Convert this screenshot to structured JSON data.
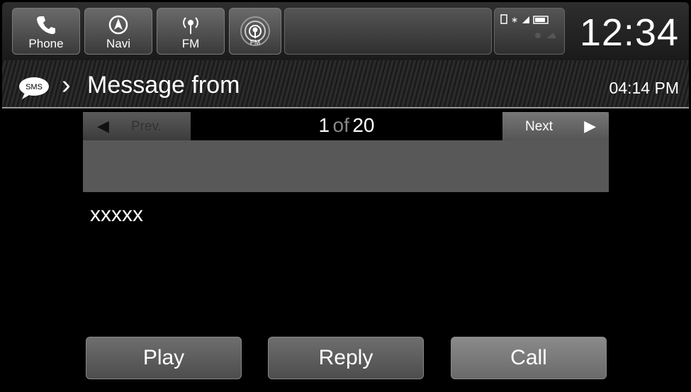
{
  "topbar": {
    "tiles": [
      {
        "label": "Phone",
        "icon": "phone-icon"
      },
      {
        "label": "Navi",
        "icon": "navi-icon"
      },
      {
        "label": "FM",
        "icon": "fm-radio-icon"
      },
      {
        "label": "",
        "icon": "fm-radio-active-icon",
        "badge": "FM"
      }
    ],
    "status_icons": [
      "phone-battery-icon",
      "bluetooth-icon",
      "signal-icon",
      "battery-icon"
    ],
    "clock": "12:34"
  },
  "header": {
    "sms_icon_text": "SMS",
    "title": "Message from",
    "time": "04:14 PM"
  },
  "pager": {
    "prev_label": "Prev.",
    "current": "1",
    "of": "of",
    "total": "20",
    "next_label": "Next"
  },
  "message": {
    "body": "xxxxx"
  },
  "actions": {
    "play": "Play",
    "reply": "Reply",
    "call": "Call"
  },
  "colors": {
    "background": "#000000",
    "panel": "#585858",
    "tile": "#5a5a5a",
    "text": "#ffffff"
  }
}
